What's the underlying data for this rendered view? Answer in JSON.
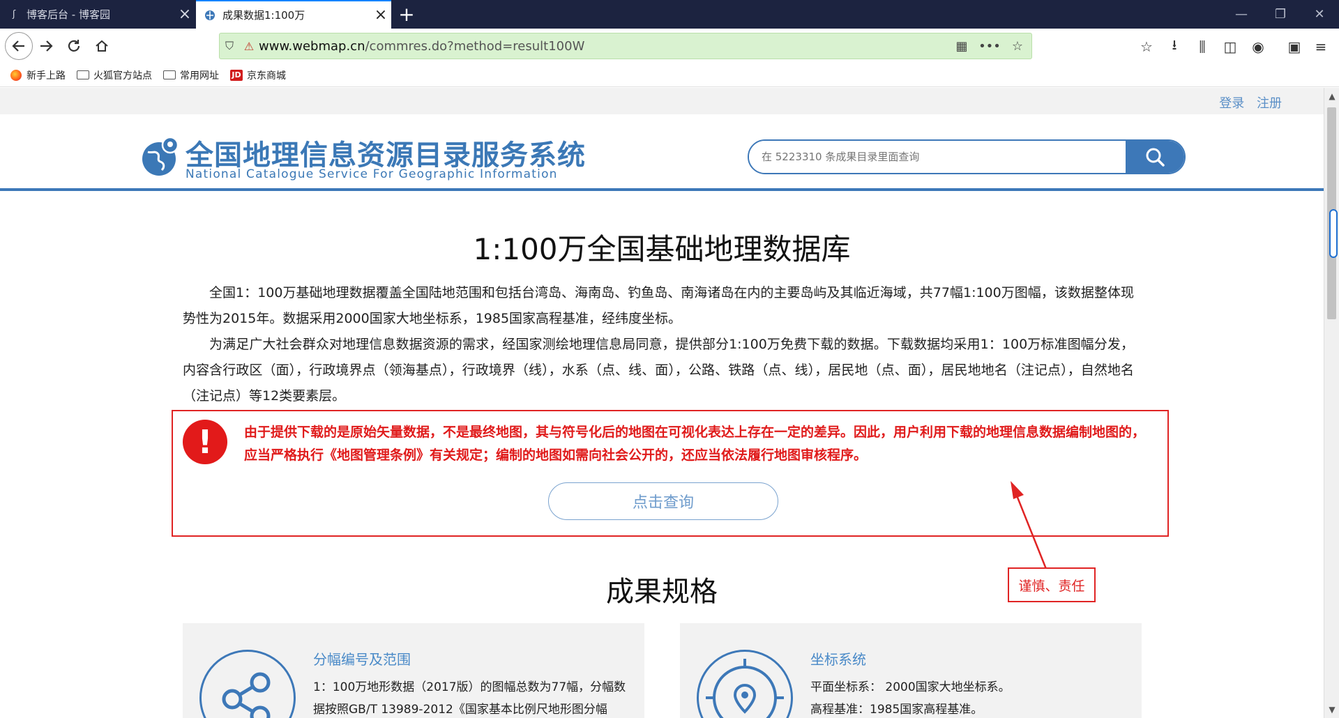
{
  "browser": {
    "tabs": [
      {
        "title": "博客后台 - 博客园",
        "active": false
      },
      {
        "title": "成果数据1:100万",
        "active": true
      }
    ],
    "url_host": "www.webmap.cn",
    "url_path": "/commres.do?method=result100W",
    "bookmarks": [
      {
        "label": "新手上路",
        "icon": "firefox-icon"
      },
      {
        "label": "火狐官方站点",
        "icon": "folder-icon"
      },
      {
        "label": "常用网址",
        "icon": "folder-icon"
      },
      {
        "label": "京东商城",
        "icon": "jd-icon"
      }
    ],
    "jd_badge": "JD"
  },
  "page": {
    "login": "登录",
    "register": "注册",
    "logo_cn": "全国地理信息资源目录服务系统",
    "logo_en": "National Catalogue Service For Geographic Information",
    "search_placeholder": "在 5223310 条成果目录里面查询",
    "title": "1:100万全国基础地理数据库",
    "para1": "全国1：100万基础地理数据覆盖全国陆地范围和包括台湾岛、海南岛、钓鱼岛、南海诸岛在内的主要岛屿及其临近海域，共77幅1:100万图幅，该数据整体现势性为2015年。数据采用2000国家大地坐标系，1985国家高程基准，经纬度坐标。",
    "para2": "为满足广大社会群众对地理信息数据资源的需求，经国家测绘地理信息局同意，提供部分1:100万免费下载的数据。下载数据均采用1：100万标准图幅分发，内容含行政区（面），行政境界点（领海基点），行政境界（线），水系（点、线、面），公路、铁路（点、线），居民地（点、面），居民地地名（注记点），自然地名（注记点）等12类要素层。",
    "warning_icon": "!",
    "warning": "由于提供下载的是原始矢量数据，不是最终地图，其与符号化后的地图在可视化表达上存在一定的差异。因此，用户利用下载的地理信息数据编制地图的，应当严格执行《地图管理条例》有关规定；编制的地图如需向社会公开的，还应当依法履行地图审核程序。",
    "query_button": "点击查询",
    "annotation": "谨慎、责任",
    "section_title": "成果规格",
    "cards": [
      {
        "title": "分幅编号及范围",
        "text": "1：100万地形数据（2017版）的图幅总数为77幅，分幅数据按照GB/T 13989-2012《国家基本比例尺地形图分幅",
        "icon": "share-icon"
      },
      {
        "title": "坐标系统",
        "text1": "平面坐标系：  2000国家大地坐标系。",
        "text2": "高程基准：1985国家高程基准。",
        "icon": "location-target-icon"
      }
    ]
  },
  "colors": {
    "brand_blue": "#3d78b8",
    "warning_red": "#e01b1b",
    "tabbar": "#1c2340",
    "urlbar_bg": "#d9f2d0"
  }
}
